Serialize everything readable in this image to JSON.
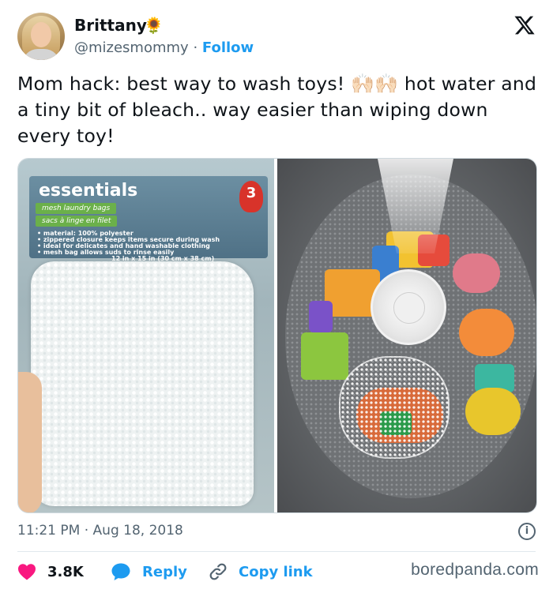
{
  "author": {
    "name": "Brittany",
    "emoji": "🌻",
    "handle": "@mizesmommy",
    "separator": "·",
    "follow_label": "Follow"
  },
  "platform_logo": "x-logo",
  "tweet": {
    "text_part1": "Mom hack: best way to wash toys! ",
    "emoji_hands": "🙌🏻🙌🏻",
    "text_part2": " hot water and a tiny bit of bleach.. way easier than wiping down every toy!"
  },
  "media": {
    "left_photo": {
      "brand": "essentials",
      "count": "3",
      "tag1": "mesh laundry bags",
      "tag2": "sacs à linge en filet",
      "lines": [
        "• material: 100% polyester",
        "• zippered closure keeps items secure during wash",
        "• ideal for delicates and hand washable clothing",
        "• mesh bag allows suds to rinse easily"
      ],
      "size": "12 in x 15 in (30 cm x 38 cm)"
    }
  },
  "footer": {
    "time": "11:21 PM",
    "separator": "·",
    "date": "Aug 18, 2018",
    "info_icon": "info-icon"
  },
  "actions": {
    "likes": "3.8K",
    "reply_label": "Reply",
    "copy_label": "Copy link"
  },
  "watermark": "boredpanda.com",
  "colors": {
    "accent": "#1d9bf0",
    "like": "#f91880",
    "text": "#0f1419",
    "secondary": "#536471"
  }
}
